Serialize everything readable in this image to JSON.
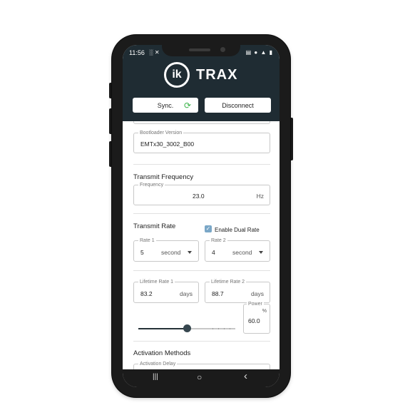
{
  "status_bar": {
    "time": "11:56",
    "left_icons": "░ ✕",
    "right_icons": "▤ ● ▲ ▮"
  },
  "app": {
    "logo_mark": "ik",
    "logo_text": "TRAX"
  },
  "header": {
    "sync_label": "Sync.",
    "sync_icon": "⟳",
    "disconnect_label": "Disconnect"
  },
  "bootloader": {
    "label": "Bootloader Version",
    "value": "EMTx30_3002_B00"
  },
  "transmit_frequency": {
    "title": "Transmit Frequency",
    "label": "Frequency",
    "value": "23.0",
    "unit": "Hz"
  },
  "transmit_rate": {
    "title": "Transmit Rate",
    "dual_rate_label": "Enable Dual Rate",
    "dual_rate_checked": true,
    "check_mark": "✓",
    "rate1": {
      "label": "Rate 1",
      "value": "5",
      "unit": "second"
    },
    "rate2": {
      "label": "Rate 2",
      "value": "4",
      "unit": "second"
    }
  },
  "lifetime": {
    "rate1": {
      "label": "Lifetime Rate 1",
      "value": "83.2",
      "unit": "days"
    },
    "rate2": {
      "label": "Lifetime Rate 2",
      "value": "88.7",
      "unit": "days"
    }
  },
  "power": {
    "label": "Power",
    "value": "60.0",
    "unit": "%",
    "slider_fraction": 0.5
  },
  "activation": {
    "title": "Activation Methods",
    "delay_label": "Activation Delay"
  },
  "navbar": {
    "recents": "|||",
    "home": "○",
    "back": "‹"
  },
  "colors": {
    "header_bg": "#1f2c33",
    "accent_green": "#3bb34a",
    "checkbox_blue": "#7aa7c7"
  }
}
